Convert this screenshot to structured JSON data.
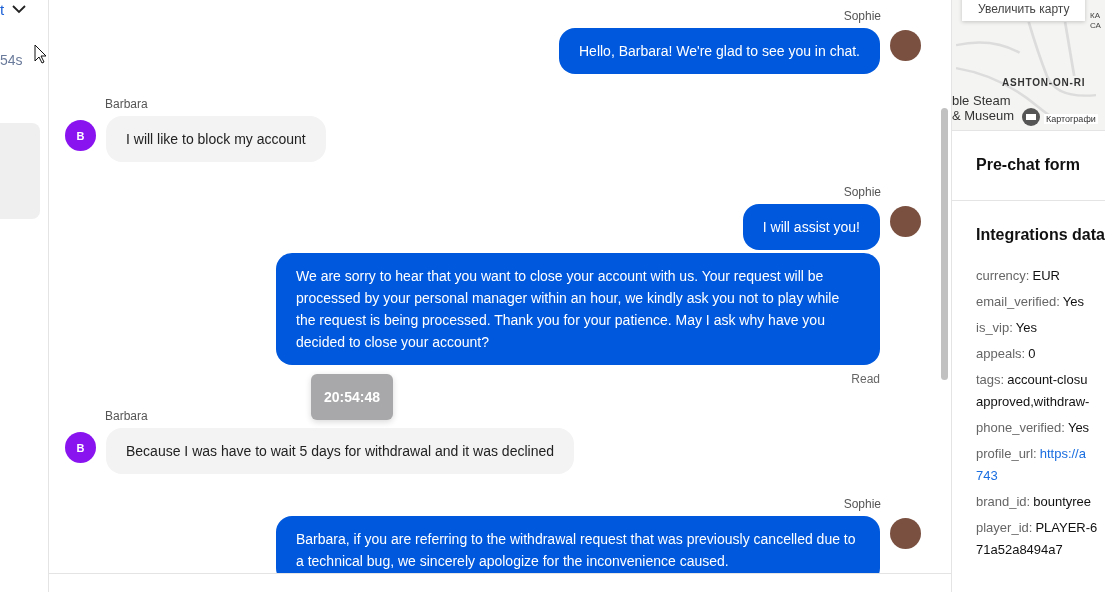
{
  "left_strip": {
    "link_fragment": "t",
    "timer": "54s"
  },
  "chat": {
    "groups": [
      {
        "kind": "agent",
        "sender": "Sophie",
        "bubbles": [
          {
            "text": "Hello, Barbara! We're glad to see you in chat."
          }
        ]
      },
      {
        "kind": "customer",
        "sender": "Barbara",
        "avatar_letter": "B",
        "bubbles": [
          {
            "text": "I will like to block my account"
          }
        ]
      },
      {
        "kind": "agent",
        "sender": "Sophie",
        "bubbles": [
          {
            "text": "I will assist you!"
          },
          {
            "text": "We are sorry to hear that you want to close your account with us. Your request will be processed by your personal manager within an hour, we kindly ask you not to play while the request is being processed. Thank you for your patience. May I ask why have you decided to close your account?"
          }
        ],
        "receipt": "Read"
      },
      {
        "kind": "customer",
        "sender": "Barbara",
        "avatar_letter": "B",
        "bubbles": [
          {
            "text": "Because I was have to wait 5 days for withdrawal and it was declined",
            "tooltip": "20:54:48"
          }
        ]
      },
      {
        "kind": "agent",
        "sender": "Sophie",
        "bubbles": [
          {
            "text": "Barbara, if you are referring to the withdrawal request that was previously cancelled due to a technical bug, we sincerely apologize for the inconvenience caused."
          }
        ]
      }
    ]
  },
  "map": {
    "zoom_button": "Увеличить карту",
    "labels": [
      "КА",
      "СА",
      "ASHTON-ON-RI",
      "ble Steam",
      "& Museum"
    ],
    "attribution": "Картографи"
  },
  "prechat": {
    "title": "Pre-chat form"
  },
  "integrations": {
    "title": "Integrations data",
    "fields": [
      {
        "key": "currency:",
        "lines": [
          "EUR"
        ],
        "kind": "text"
      },
      {
        "key": "email_verified:",
        "lines": [
          "Yes"
        ],
        "kind": "text"
      },
      {
        "key": "is_vip:",
        "lines": [
          "Yes"
        ],
        "kind": "text"
      },
      {
        "key": "appeals:",
        "lines": [
          "0"
        ],
        "kind": "text"
      },
      {
        "key": "tags:",
        "lines": [
          "account-closu",
          "approved,withdraw-"
        ],
        "kind": "text"
      },
      {
        "key": "phone_verified:",
        "lines": [
          "Yes"
        ],
        "kind": "text"
      },
      {
        "key": "profile_url:",
        "lines": [
          "https://a",
          "743"
        ],
        "kind": "link"
      },
      {
        "key": "brand_id:",
        "lines": [
          "bountyree"
        ],
        "kind": "text"
      },
      {
        "key": "player_id:",
        "lines": [
          "PLAYER-6",
          "71a52a8494a7"
        ],
        "kind": "text"
      }
    ]
  }
}
